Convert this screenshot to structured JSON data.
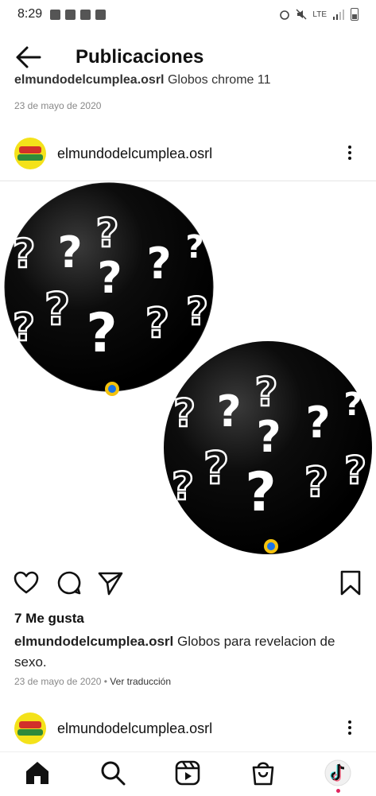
{
  "status": {
    "time": "8:29",
    "network": "LTE"
  },
  "header": {
    "title": "Publicaciones"
  },
  "previous_post": {
    "username": "elmundodelcumplea.osrl",
    "caption_text": "Globos chrome 11",
    "date": "23 de mayo de 2020"
  },
  "post": {
    "username": "elmundodelcumplea.osrl",
    "likes": "7 Me gusta",
    "caption_user": "elmundodelcumplea.osrl",
    "caption_text": "Globos para revelacion de sexo.",
    "date": "23 de mayo de 2020",
    "translate": "Ver traducción",
    "image_icons": [
      "black-balloon-question-marks",
      "black-balloon-question-marks"
    ]
  },
  "next_post": {
    "username": "elmundodelcumplea.osrl"
  },
  "nav": {
    "items": [
      "home-icon",
      "search-icon",
      "reels-icon",
      "shop-icon",
      "profile-avatar"
    ]
  },
  "colors": {
    "accent_red": "#e0245e",
    "avatar_yellow": "#f4e21a",
    "text": "#111111",
    "muted": "#888888"
  }
}
